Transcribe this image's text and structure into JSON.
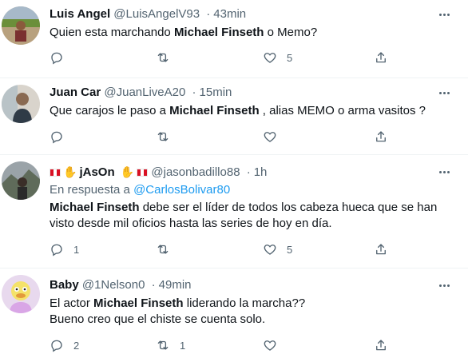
{
  "tweets": [
    {
      "name": "Luis Angel",
      "handle": "@LuisAngelV93",
      "time": "43min",
      "text_before": "Quien esta marchando ",
      "text_bold": "Michael Finseth",
      "text_after": " o Memo?",
      "reply_count": "",
      "retweet_count": "",
      "like_count": "5"
    },
    {
      "name": "Juan Car",
      "handle": "@JuanLiveA20",
      "time": "15min",
      "text_before": "Que carajos le  paso a ",
      "text_bold": "Michael Finseth",
      "text_after": " , alias MEMO o arma vasitos ?",
      "reply_count": "",
      "retweet_count": "",
      "like_count": ""
    },
    {
      "name": "jAsOn",
      "handle": "@jasonbadillo88",
      "time": "1h",
      "reply_label": "En respuesta a",
      "reply_target": "@CarlosBolivar80",
      "text_bold": "Michael Finseth",
      "text_after": " debe ser el líder de todos los cabeza hueca que se han",
      "text_line2": "visto desde mil oficios hasta las series de hoy en día.",
      "reply_count": "1",
      "retweet_count": "",
      "like_count": "5"
    },
    {
      "name": "Baby",
      "handle": "@1Nelson0",
      "time": "49min",
      "text_before": "El actor ",
      "text_bold": "Michael Finseth",
      "text_after": " liderando la marcha??",
      "text_line2": "Bueno creo que el chiste se cuenta solo.",
      "reply_count": "2",
      "retweet_count": "1",
      "like_count": ""
    }
  ],
  "separator": "·",
  "icons": {
    "reply": "reply-icon",
    "retweet": "retweet-icon",
    "like": "heart-icon",
    "share": "share-icon",
    "more": "more-icon"
  },
  "colors": {
    "link": "#1d9bf0",
    "secondary": "#536471",
    "flag_red": "#d91023"
  }
}
